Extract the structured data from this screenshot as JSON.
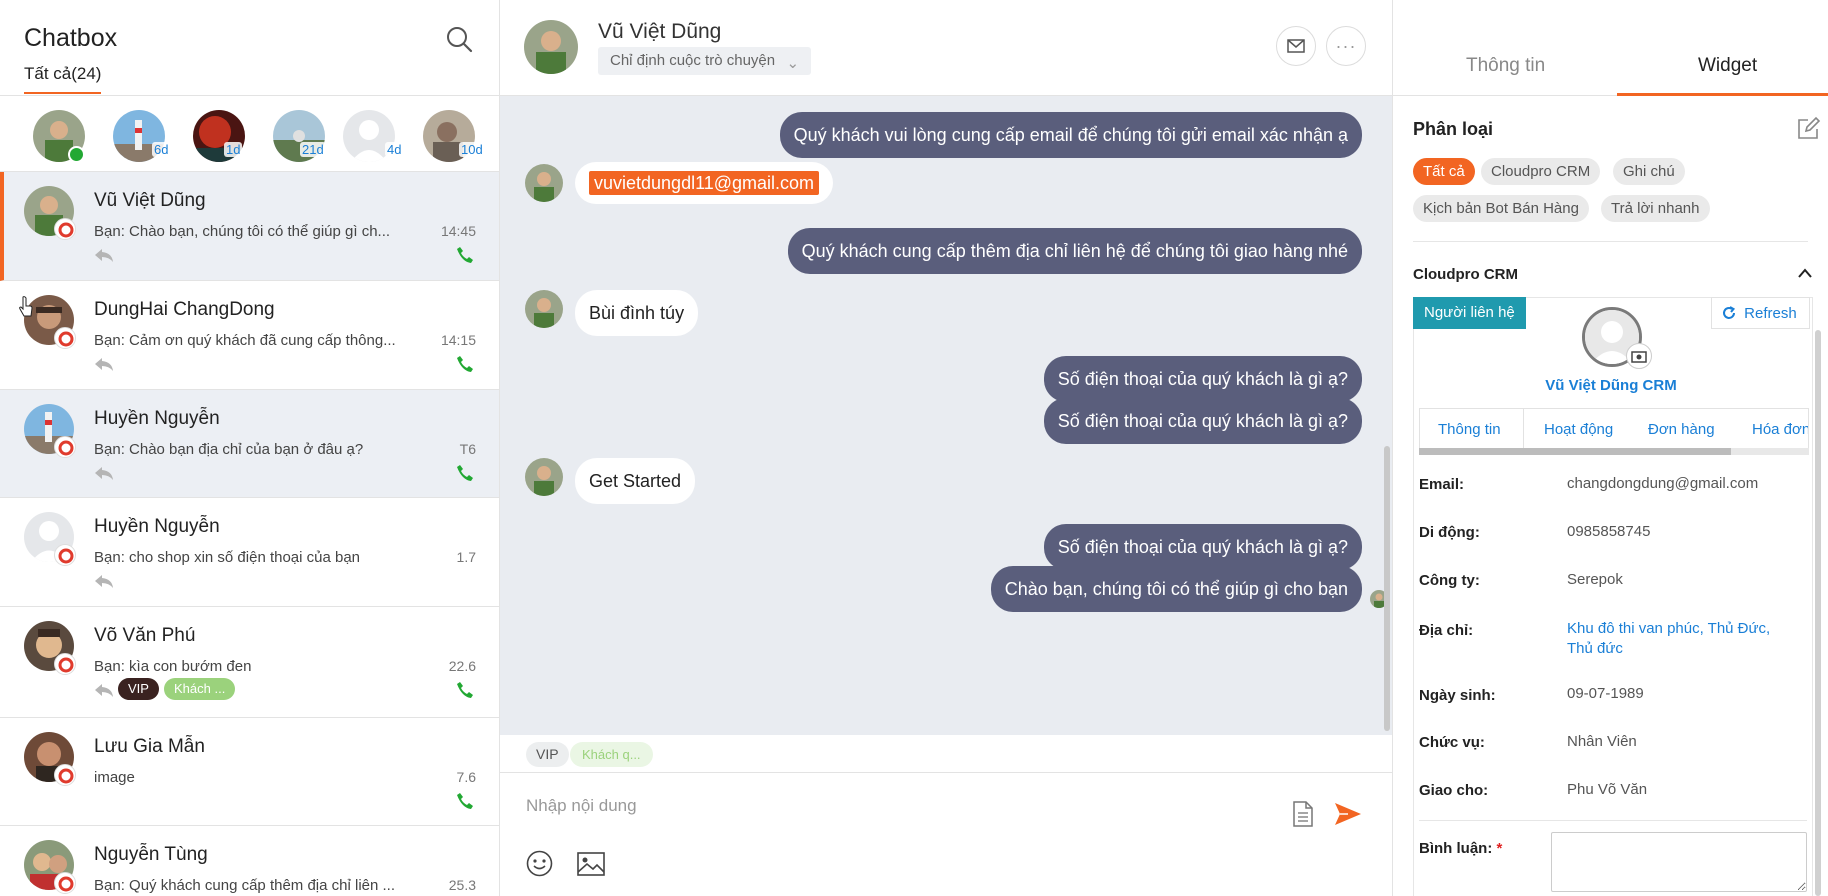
{
  "sidebar": {
    "title": "Chatbox",
    "tab_all": "Tất cả(24)",
    "recent_badges": [
      "",
      "6d",
      "1d",
      "21d",
      "4d",
      "10d"
    ],
    "conversations": [
      {
        "name": "Vũ Việt Dũng",
        "preview": "Bạn: Chào bạn, chúng tôi có thể giúp gì ch...",
        "time": "14:45"
      },
      {
        "name": "DungHai ChangDong",
        "preview": "Bạn: Cảm ơn quý khách đã cung cấp thông...",
        "time": "14:15"
      },
      {
        "name": "Huyền Nguyễn",
        "preview": "Bạn: Chào bạn địa chỉ của bạn ở đâu ạ?",
        "time": "T6"
      },
      {
        "name": "Huyền Nguyễn",
        "preview": "Bạn: cho shop xin số điện thoại của bạn",
        "time": "1.7"
      },
      {
        "name": "Võ Văn Phú",
        "preview": "Bạn: kìa con bướm đen",
        "time": "22.6",
        "tags": [
          "VIP",
          "Khách ..."
        ]
      },
      {
        "name": "Lưu Gia Mẫn",
        "preview": " image",
        "time": "7.6"
      },
      {
        "name": "Nguyễn Tùng",
        "preview": "Bạn: Quý khách cung cấp thêm địa chỉ liên ...",
        "time": "25.3"
      }
    ]
  },
  "chat": {
    "contact_name": "Vũ Việt Dũng",
    "assign_label": "Chỉ định cuộc trò chuyện",
    "messages": [
      {
        "dir": "out",
        "text": "Quý khách vui lòng cung cấp email để chúng tôi gửi email xác nhận ạ"
      },
      {
        "dir": "in",
        "text": "vuvietdungdl11@gmail.com"
      },
      {
        "dir": "out",
        "text": "Quý khách cung cấp thêm địa chỉ liên hệ để chúng tôi giao hàng nhé"
      },
      {
        "dir": "in",
        "text": "Bùi đình túy"
      },
      {
        "dir": "out",
        "text": "Số điện thoại của quý khách là gì ạ?"
      },
      {
        "dir": "out",
        "text": "Số điện thoại của quý khách là gì ạ?"
      },
      {
        "dir": "in",
        "text": "Get Started"
      },
      {
        "dir": "out",
        "text": "Số điện thoại của quý khách là gì ạ?"
      },
      {
        "dir": "out",
        "text": "Chào bạn, chúng tôi có thể giúp gì cho bạn"
      }
    ],
    "tags": [
      "VIP",
      "Khách q..."
    ],
    "composer_placeholder": "Nhập nội dung"
  },
  "panel": {
    "tabs": [
      "Thông tin",
      "Widget"
    ],
    "active_tab": "Widget",
    "category_title": "Phân loại",
    "categories": [
      "Tất cả",
      "Cloudpro CRM",
      "Ghi chú",
      "Kịch bản Bot Bán Hàng",
      "Trả lời nhanh"
    ],
    "crm_title": "Cloudpro CRM",
    "contact_button": "Người liên hệ",
    "refresh_button": "Refresh",
    "crm_contact_name": "Vũ Việt Dũng CRM",
    "crm_tabs": [
      "Thông tin",
      "Hoạt động",
      "Đơn hàng",
      "Hóa đơn"
    ],
    "fields": [
      {
        "label": "Email:",
        "value": "changdongdung@gmail.com"
      },
      {
        "label": "Di động:",
        "value": "0985858745"
      },
      {
        "label": "Công ty:",
        "value": "Serepok"
      },
      {
        "label": "Địa chỉ:",
        "value": "Khu đô thi van phúc, Thủ Đức, Thủ đức"
      },
      {
        "label": "Ngày sinh:",
        "value": "09-07-1989"
      },
      {
        "label": "Chức vụ:",
        "value": "Nhân Viên"
      },
      {
        "label": "Giao cho:",
        "value": "Phu Võ Văn"
      }
    ],
    "comment_label": "Bình luận:",
    "comment_required": "*"
  },
  "colors": {
    "accent": "#f26522",
    "bubble_out": "#5a5e7c",
    "chat_bg": "#e9ecf1",
    "link": "#1a7fd6",
    "teal": "#1f9aae",
    "online": "#22a833"
  },
  "icons": [
    "search-icon",
    "mail-icon",
    "more-icon",
    "reply-icon",
    "phone-icon",
    "emoji-icon",
    "image-icon",
    "file-icon",
    "send-icon",
    "edit-icon",
    "chevron-up-icon",
    "refresh-icon",
    "camera-icon"
  ]
}
